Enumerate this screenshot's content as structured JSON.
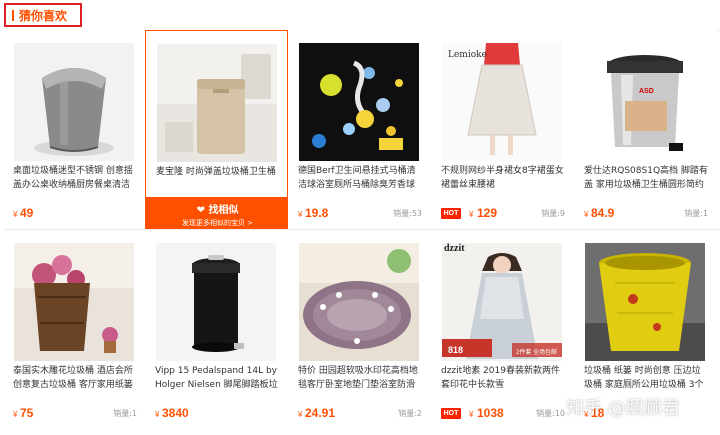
{
  "section": {
    "title": "猜你喜欢"
  },
  "products": [
    {
      "title": "桌面垃圾桶迷型不锈钢 创意揺盖办公桌收纳桶厨房餐桌清洁筒",
      "price": "49",
      "sales": "",
      "hot": false,
      "image": "mini-steel-bin"
    },
    {
      "title": "麦宝隆 时尚弹盖垃圾桶卫生桶",
      "price": "",
      "sales": "",
      "hot": false,
      "image": "beige-bin-bathroom",
      "hover": {
        "main": "找相似",
        "sub": "发现更多相似的宝贝 >",
        "icon": "heart-icon"
      }
    },
    {
      "title": "德国Berf卫生间悬挂式马桶清洁球浴室厕所马桶除臭芳香球洁厕",
      "price": "19.8",
      "sales": "销量:53",
      "hot": false,
      "image": "toilet-freshener-balls"
    },
    {
      "title": "不规则网纱半身裙女8字裙蛋女裙蕾丝束腰裙",
      "price": "129",
      "sales": "销量:9",
      "hot": true,
      "hot_label": "HOT",
      "image": "mesh-skirt-model"
    },
    {
      "title": "爱仕达RQS08S1Q高档 脚踏有盖 家用垃圾桶卫生桶圆形简约",
      "price": "84.9",
      "sales": "销量:1",
      "hot": false,
      "image": "pedal-bin-steel"
    },
    {
      "title": "泰国实木雕花垃圾桶 酒店会所创意复古垃圾桶 客厅家用纸篓",
      "price": "75",
      "sales": "销量:1",
      "hot": false,
      "image": "wooden-bin-flowers"
    },
    {
      "title": "Vipp 15 Pedalspand 14L by Holger Nielsen 脚尾脚踏板垃圾",
      "price": "3840",
      "sales": "",
      "hot": false,
      "image": "black-pedal-bin"
    },
    {
      "title": "特价 田园超软吸水印花高档地毯客厅卧室地垫门垫浴室防滑垫",
      "price": "24.91",
      "sales": "销量:2",
      "hot": false,
      "image": "oval-rug"
    },
    {
      "title": "dzzit地素 2019春装新款两件套印花中长款雪",
      "price": "1038",
      "sales": "销量:10",
      "hot": true,
      "hot_label": "HOT",
      "image": "dzzit-dress-model",
      "overlay_text": "dzzit",
      "badge_price": "818",
      "badge_note": "2件套 全场包邮"
    },
    {
      "title": "垃圾桶 纸篓 时尚创意 压边垃圾桶 家庭厕所公用垃圾桶 3个包",
      "price": "18",
      "sales": "",
      "hot": false,
      "image": "yellow-bin"
    }
  ],
  "watermark": "知乎 @照顾君",
  "currency": "¥",
  "colors": {
    "accent": "#ff5000",
    "hot": "#ff2400",
    "border": "#e02020"
  }
}
